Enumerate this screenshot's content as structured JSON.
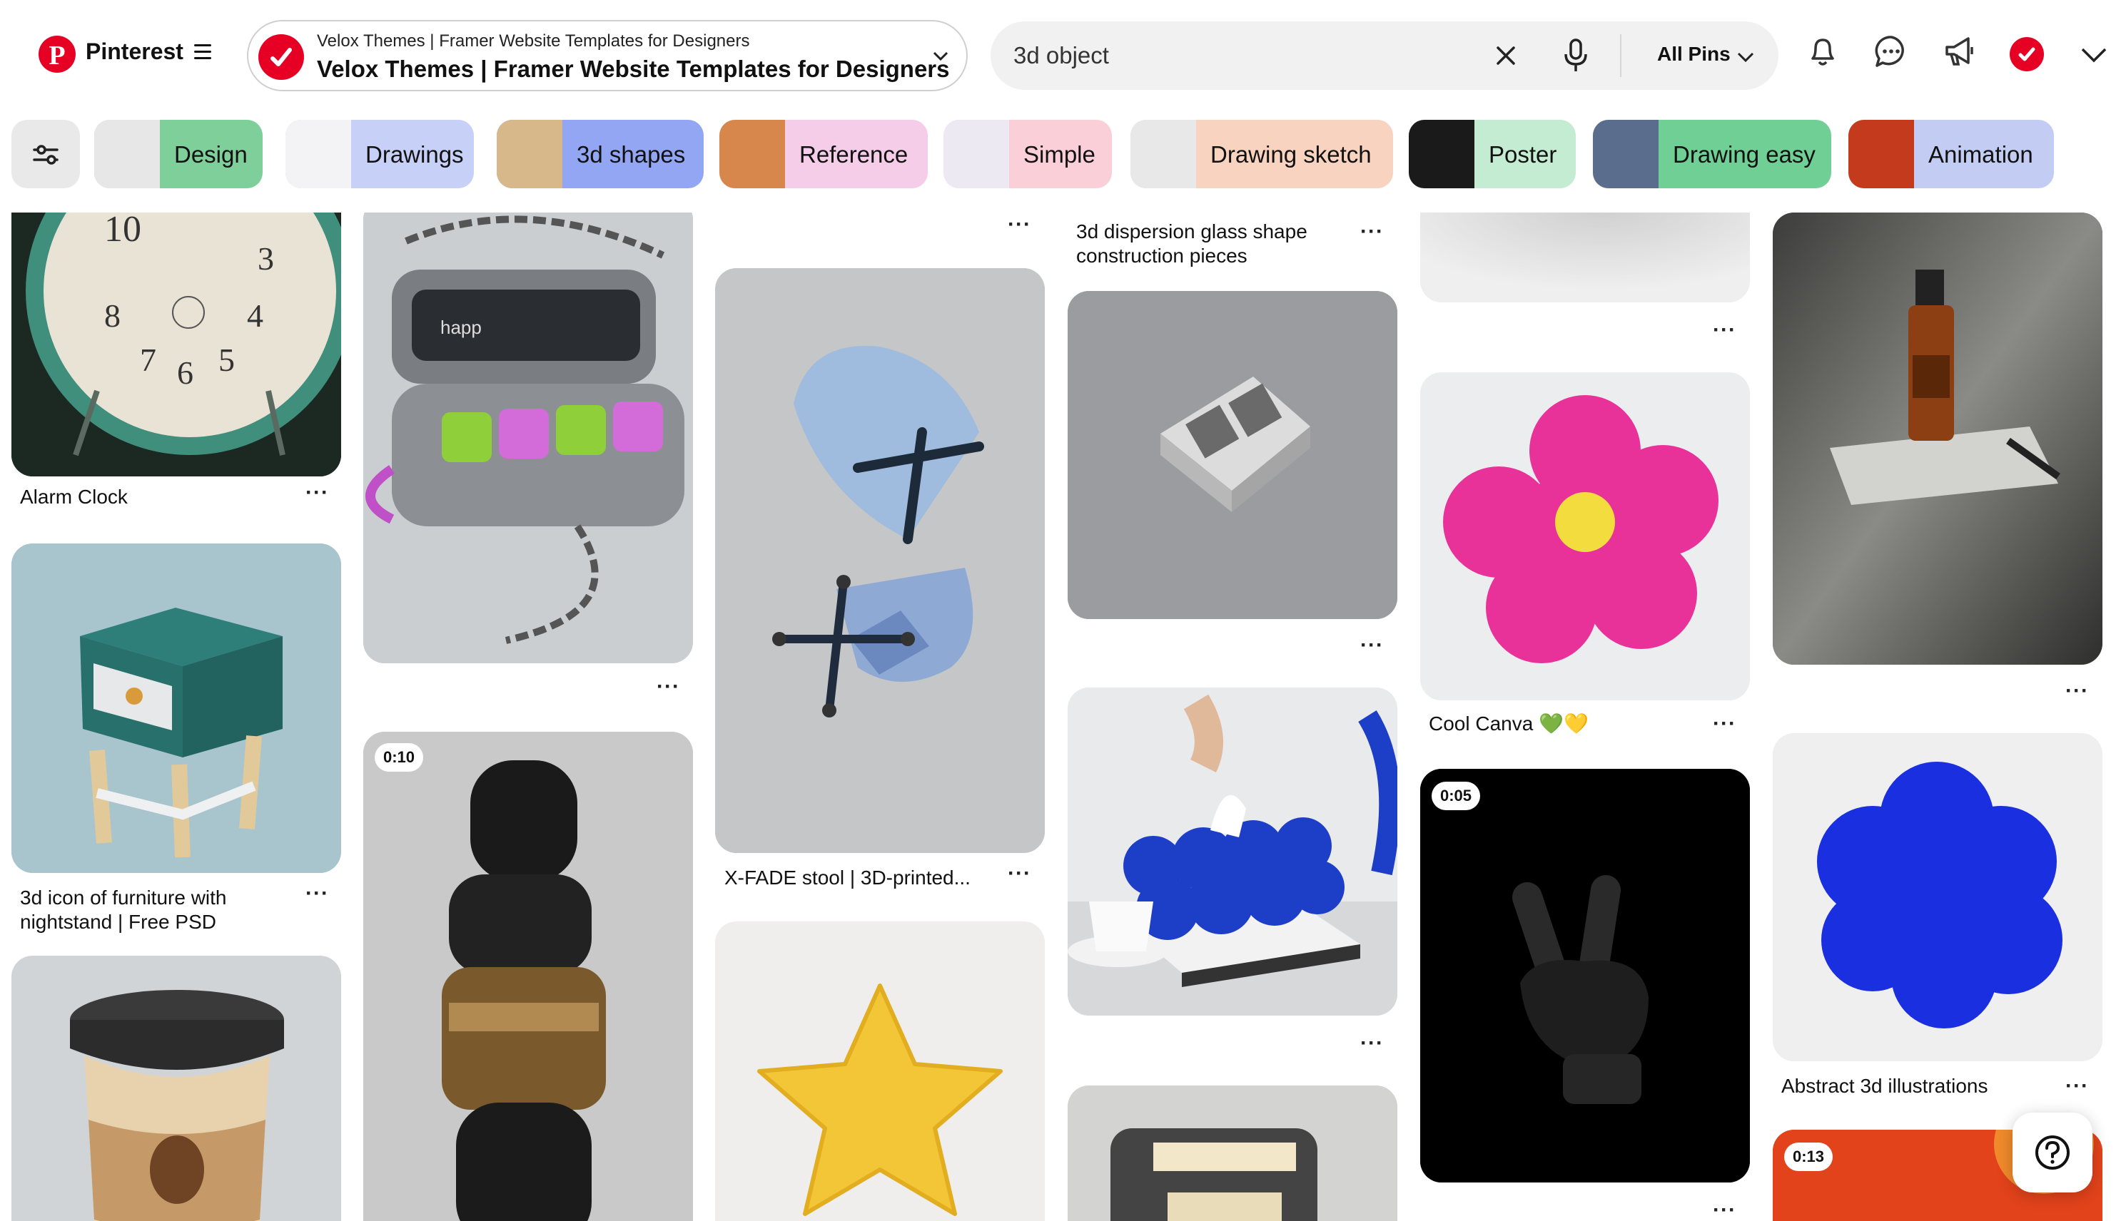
{
  "header": {
    "brand": "Pinterest",
    "board_line1": "Velox Themes | Framer Website Templates for Designers",
    "board_line2": "Velox Themes | Framer Website Templates for Designers",
    "search_value": "3d object",
    "filter_label": "All Pins"
  },
  "chips": [
    {
      "label": "Design",
      "bg": "#7fcf9a"
    },
    {
      "label": "Drawings",
      "bg": "#c7d0f7"
    },
    {
      "label": "3d shapes",
      "bg": "#93a6f4"
    },
    {
      "label": "Reference",
      "bg": "#f5cde8"
    },
    {
      "label": "Simple",
      "bg": "#fbcfd8"
    },
    {
      "label": "Drawing sketch",
      "bg": "#f7d3c0"
    },
    {
      "label": "Poster",
      "bg": "#c3ecd2"
    },
    {
      "label": "Drawing easy",
      "bg": "#6fcf94"
    },
    {
      "label": "Animation",
      "bg": "#c3cdf4"
    }
  ],
  "pins": {
    "alarm_clock": "Alarm Clock",
    "nightstand_line1": "3d icon of furniture with",
    "nightstand_line2": "nightstand | Free PSD",
    "video_duration_1": "0:10",
    "xfade": "X-FADE stool | 3D-printed...",
    "dispersion_line1": "3d dispersion glass shape",
    "dispersion_line2": "construction pieces",
    "cool_canva": "Cool Canva 💚💛",
    "video_duration_2": "0:05",
    "abstract": "Abstract 3d illustrations",
    "video_duration_3": "0:13"
  },
  "colors": {
    "brand_red": "#e60023",
    "search_bg": "#f1f1f1",
    "chip_filter_bg": "#e9e9e9"
  }
}
